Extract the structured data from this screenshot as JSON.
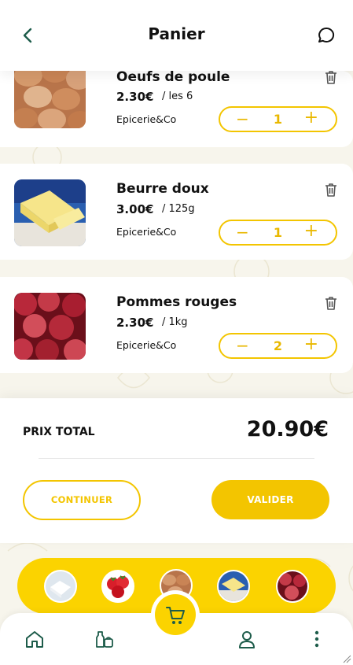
{
  "header": {
    "title": "Panier",
    "back_icon": "chevron-left-icon",
    "chat_icon": "chat-bubble-icon"
  },
  "cart_items": [
    {
      "name": "Oeufs de poule",
      "price": "2.30€",
      "unit": "/ les 6",
      "shop": "Epicerie&Co",
      "quantity": "1",
      "image": "eggs"
    },
    {
      "name": "Beurre doux",
      "price": "3.00€",
      "unit": "/ 125g",
      "shop": "Epicerie&Co",
      "quantity": "1",
      "image": "butter"
    },
    {
      "name": "Pommes rouges",
      "price": "2.30€",
      "unit": "/ 1kg",
      "shop": "Epicerie&Co",
      "quantity": "2",
      "image": "apples"
    }
  ],
  "total": {
    "label": "PRIX TOTAL",
    "value": "20.90€"
  },
  "actions": {
    "continue_label": "CONTINUER",
    "validate_label": "VALIDER"
  },
  "mini_cart": [
    "milk-product",
    "strawberries",
    "eggs",
    "butter",
    "apples"
  ],
  "bottom_nav": [
    "home-icon",
    "grocery-icon",
    "cart-icon",
    "profile-icon",
    "more-vertical-icon"
  ],
  "colors": {
    "accent": "#f3c500",
    "strip": "#fbd300",
    "icon_green": "#1d5c4a"
  }
}
